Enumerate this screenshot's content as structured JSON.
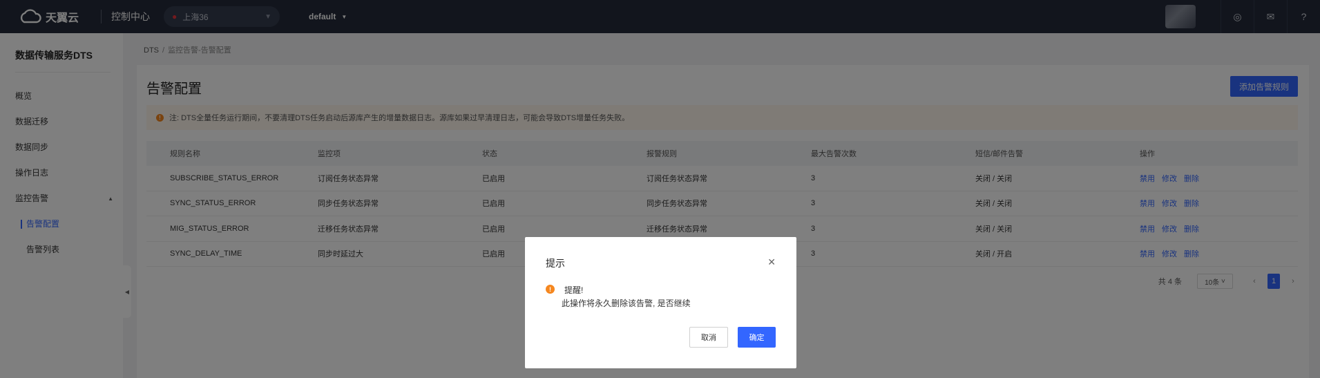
{
  "header": {
    "logo_text": "天翼云",
    "console_label": "控制中心",
    "region": "上海36",
    "project": "default",
    "icons": [
      "target-icon",
      "mail-icon",
      "help-icon"
    ]
  },
  "sidebar": {
    "service_title": "数据传输服务DTS",
    "items": [
      {
        "label": "概览"
      },
      {
        "label": "数据迁移"
      },
      {
        "label": "数据同步"
      },
      {
        "label": "操作日志"
      },
      {
        "label": "监控告警"
      }
    ],
    "sub_items": [
      {
        "label": "告警配置",
        "active": true
      },
      {
        "label": "告警列表",
        "active": false
      }
    ]
  },
  "breadcrumb": {
    "root": "DTS",
    "separator": "/",
    "current": "监控告警-告警配置"
  },
  "page": {
    "title": "告警配置",
    "add_button": "添加告警规则",
    "notice": "注: DTS全量任务运行期间，不要清理DTS任务启动后源库产生的增量数据日志。源库如果过早清理日志，可能会导致DTS增量任务失败。"
  },
  "table": {
    "columns": [
      "规则名称",
      "监控项",
      "状态",
      "报警规则",
      "最大告警次数",
      "短信/邮件告警",
      "操作"
    ],
    "rows": [
      {
        "name": "SUBSCRIBE_STATUS_ERROR",
        "monitor": "订阅任务状态异常",
        "status": "已启用",
        "rule": "订阅任务状态异常",
        "max": "3",
        "notify": "关闭 / 关闭"
      },
      {
        "name": "SYNC_STATUS_ERROR",
        "monitor": "同步任务状态异常",
        "status": "已启用",
        "rule": "同步任务状态异常",
        "max": "3",
        "notify": "关闭 / 关闭"
      },
      {
        "name": "MIG_STATUS_ERROR",
        "monitor": "迁移任务状态异常",
        "status": "已启用",
        "rule": "迁移任务状态异常",
        "max": "3",
        "notify": "关闭 / 关闭"
      },
      {
        "name": "SYNC_DELAY_TIME",
        "monitor": "同步时延过大",
        "status": "已启用",
        "rule": "",
        "max": "3",
        "notify": "关闭 / 开启"
      }
    ],
    "ops": {
      "disable": "禁用",
      "edit": "修改",
      "delete": "删除"
    }
  },
  "pager": {
    "total": "共 4 条",
    "page_size": "10条",
    "current": "1"
  },
  "dialog": {
    "title": "提示",
    "heading": "提醒!",
    "message": "此操作将永久删除该告警, 是否继续",
    "cancel": "取消",
    "confirm": "确定"
  },
  "colors": {
    "primary": "#3366ff",
    "topbar": "#252b3a",
    "warning": "#f5871f"
  }
}
